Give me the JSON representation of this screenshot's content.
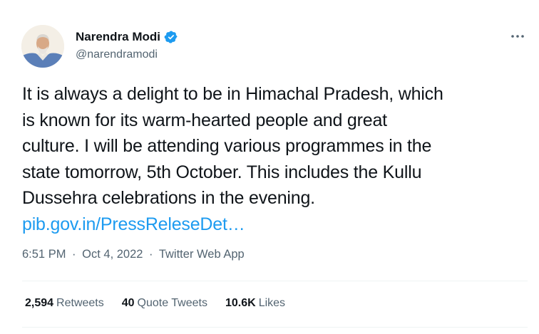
{
  "author": {
    "name": "Narendra Modi",
    "handle": "@narendramodi",
    "verified": true,
    "avatar_icon": "profile-photo"
  },
  "tweet": {
    "lines": [
      "It is always a delight to be in Himachal Pradesh, which",
      "is known for its warm-hearted people and great",
      "culture. I will be attending various programmes in the",
      "state tomorrow, 5th October. This includes the Kullu",
      "Dussehra celebrations in the evening."
    ],
    "link_text": "pib.gov.in/PressReleseDet…"
  },
  "meta": {
    "time": "6:51 PM",
    "separator": "·",
    "date": "Oct 4, 2022",
    "source": "Twitter Web App"
  },
  "stats": {
    "retweets_count": "2,594",
    "retweets_label": "Retweets",
    "quotes_count": "40",
    "quotes_label": "Quote Tweets",
    "likes_count": "10.6K",
    "likes_label": "Likes"
  },
  "colors": {
    "link": "#1d9bf0",
    "secondary_text": "#536471",
    "verified_badge": "#1d9bf0"
  }
}
